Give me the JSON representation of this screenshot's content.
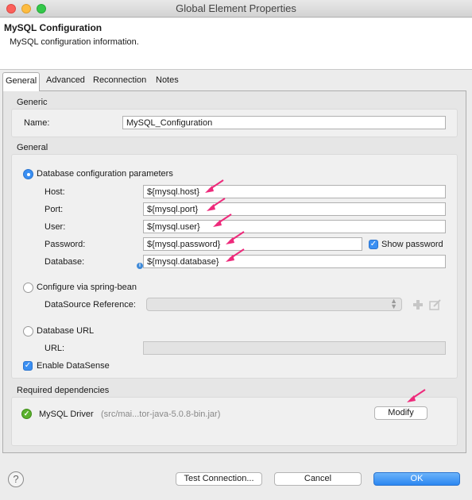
{
  "window": {
    "title": "Global Element Properties"
  },
  "header": {
    "title": "MySQL Configuration",
    "description": "MySQL configuration information."
  },
  "tabs": [
    {
      "label": "General",
      "active": true
    },
    {
      "label": "Advanced",
      "active": false
    },
    {
      "label": "Reconnection",
      "active": false
    },
    {
      "label": "Notes",
      "active": false
    }
  ],
  "generic": {
    "section_label": "Generic",
    "name_label": "Name:",
    "name_value": "MySQL_Configuration"
  },
  "general": {
    "section_label": "General",
    "db_params_label": "Database configuration parameters",
    "host_label": "Host:",
    "host_value": "${mysql.host}",
    "port_label": "Port:",
    "port_value": "${mysql.port}",
    "user_label": "User:",
    "user_value": "${mysql.user}",
    "password_label": "Password:",
    "password_value": "${mysql.password}",
    "show_password_label": "Show password",
    "database_label": "Database:",
    "database_value": "${mysql.database}",
    "spring_bean_label": "Configure via spring-bean",
    "datasource_label": "DataSource Reference:",
    "db_url_label": "Database URL",
    "url_label": "URL:",
    "enable_datasense_label": "Enable DataSense"
  },
  "dependencies": {
    "section_label": "Required dependencies",
    "driver_name": "MySQL Driver",
    "driver_path": "(src/mai...tor-java-5.0.8-bin.jar)",
    "modify_label": "Modify"
  },
  "footer": {
    "test_connection_label": "Test Connection...",
    "cancel_label": "Cancel",
    "ok_label": "OK"
  },
  "colors": {
    "accent": "#3a8ff2",
    "annotation_arrow": "#ee2a7b",
    "status_ok": "#5ab12d"
  }
}
